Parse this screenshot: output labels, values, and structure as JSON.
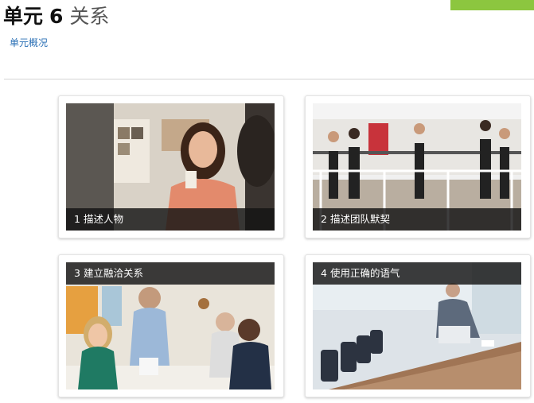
{
  "header": {
    "unit_label": "单元",
    "unit_number": "6",
    "unit_topic": "关系",
    "overview_link": "单元概况"
  },
  "modules": [
    {
      "number": "1",
      "title": "描述人物"
    },
    {
      "number": "2",
      "title": "描述团队默契"
    },
    {
      "number": "3",
      "title": "建立融洽关系"
    },
    {
      "number": "4",
      "title": "使用正确的语气"
    }
  ],
  "colors": {
    "accent_green": "#8cc63f",
    "link_blue": "#2a6fb5",
    "caption_bg": "#141414"
  }
}
